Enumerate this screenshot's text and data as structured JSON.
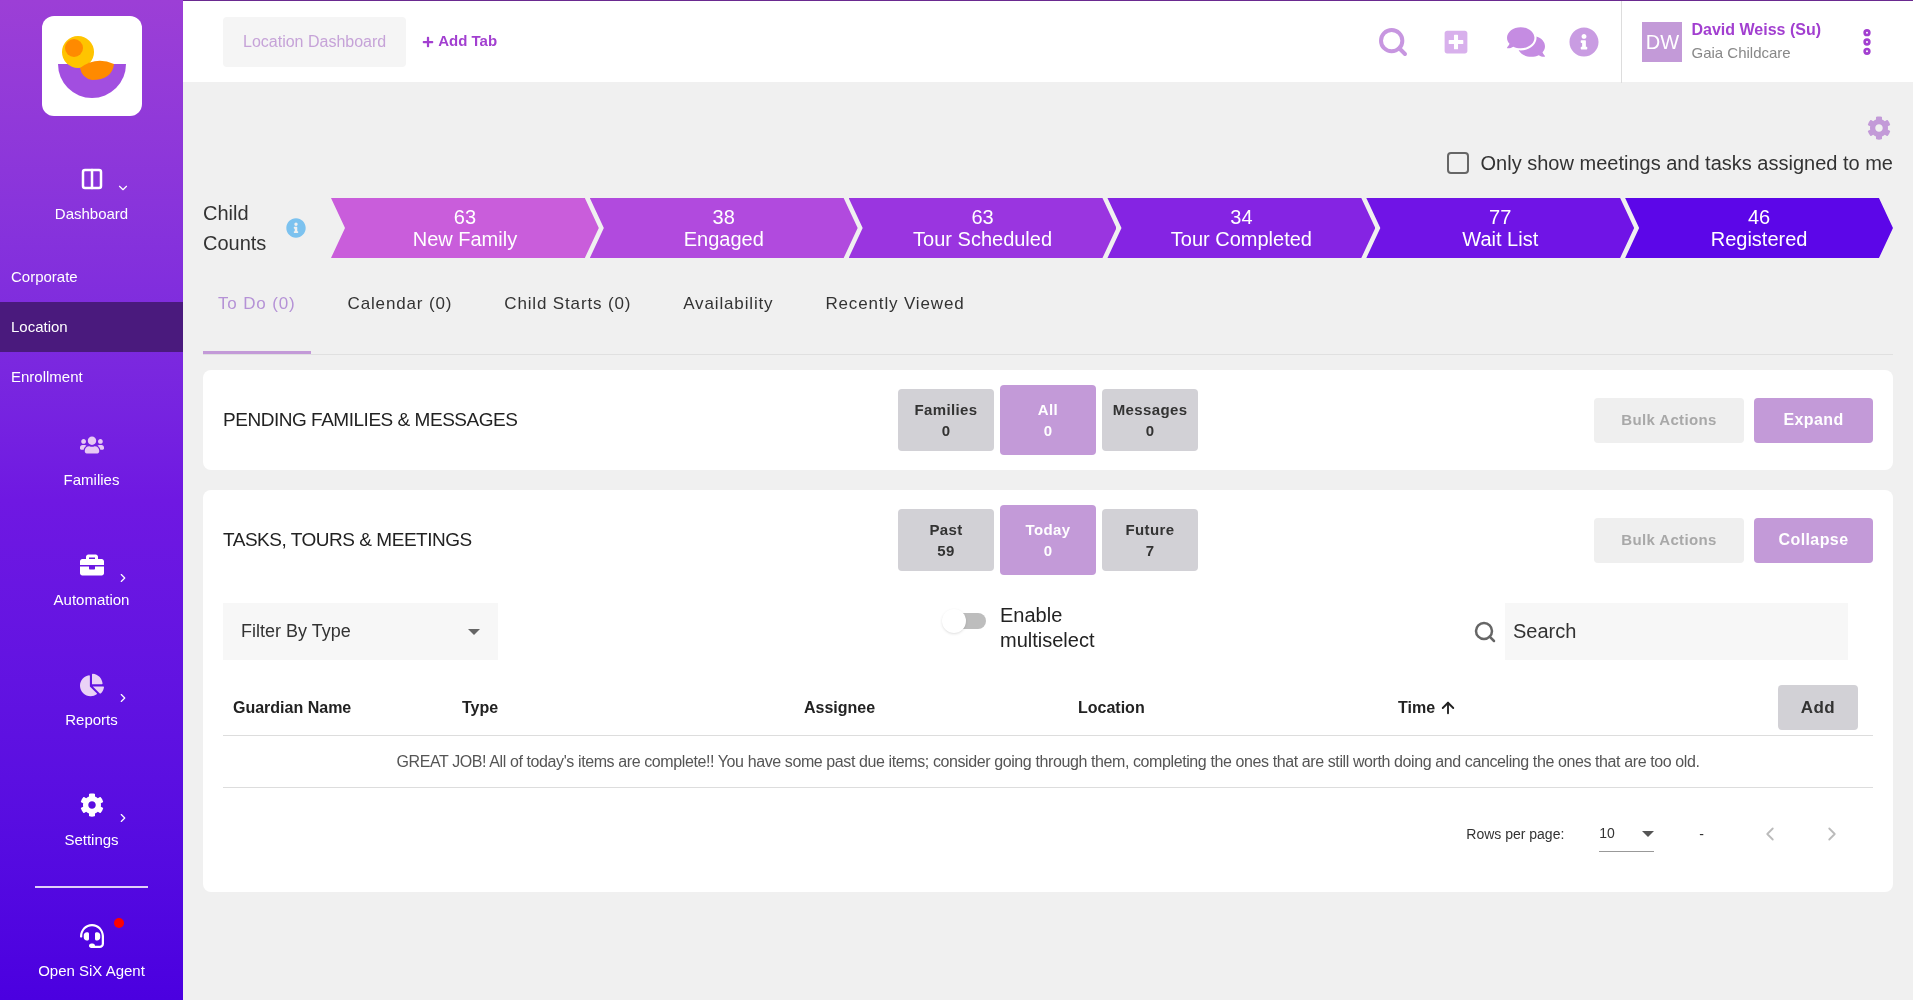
{
  "sidebar": {
    "items": [
      {
        "label": "Dashboard",
        "kind": "menu",
        "expanded": true,
        "children": [
          {
            "label": "Corporate",
            "selected": false
          },
          {
            "label": "Location",
            "selected": true
          },
          {
            "label": "Enrollment",
            "selected": false
          }
        ]
      },
      {
        "label": "Families",
        "kind": "link"
      },
      {
        "label": "Automation",
        "kind": "menu",
        "expanded": false
      },
      {
        "label": "Reports",
        "kind": "menu",
        "expanded": false
      },
      {
        "label": "Settings",
        "kind": "menu",
        "expanded": false
      }
    ],
    "agent": {
      "label": "Open SiX Agent",
      "alert": true
    }
  },
  "top_bar": {
    "tabs": [
      {
        "label": "Location Dashboard",
        "selected": true
      }
    ],
    "add_tab": "Add Tab",
    "user": {
      "initials": "DW",
      "name": "David Weiss (Su)",
      "organization": "Gaia Childcare"
    }
  },
  "assigned_filter": {
    "label": "Only show meetings and tasks assigned to me",
    "checked": false
  },
  "child_counts": {
    "label": "Child Counts",
    "stages": [
      {
        "count": "63",
        "name": "New Family",
        "color": "#c95ddb"
      },
      {
        "count": "38",
        "name": "Engaged",
        "color": "#b14ade"
      },
      {
        "count": "63",
        "name": "Tour Scheduled",
        "color": "#9a35e0"
      },
      {
        "count": "34",
        "name": "Tour Completed",
        "color": "#8524e3"
      },
      {
        "count": "77",
        "name": "Wait List",
        "color": "#7014e6"
      },
      {
        "count": "46",
        "name": "Registered",
        "color": "#5c06e8"
      }
    ]
  },
  "tabs": [
    {
      "label": "To Do (0)",
      "selected": true
    },
    {
      "label": "Calendar (0)",
      "selected": false
    },
    {
      "label": "Child Starts (0)",
      "selected": false
    },
    {
      "label": "Availability",
      "selected": false
    },
    {
      "label": "Recently Viewed",
      "selected": false
    }
  ],
  "pending": {
    "title": "PENDING FAMILIES & MESSAGES",
    "filters": [
      {
        "label": "Families",
        "count": "0",
        "selected": false
      },
      {
        "label": "All",
        "count": "0",
        "selected": true
      },
      {
        "label": "Messages",
        "count": "0",
        "selected": false
      }
    ],
    "bulk_actions": {
      "label": "Bulk Actions",
      "disabled": true
    },
    "toggle_button": "Expand"
  },
  "tasks": {
    "title": "TASKS, TOURS & MEETINGS",
    "filters": [
      {
        "label": "Past",
        "count": "59",
        "selected": false
      },
      {
        "label": "Today",
        "count": "0",
        "selected": true
      },
      {
        "label": "Future",
        "count": "7",
        "selected": false
      }
    ],
    "bulk_actions": {
      "label": "Bulk Actions",
      "disabled": true
    },
    "toggle_button": "Collapse",
    "type_filter": "Filter By Type",
    "multiselect": {
      "label": "Enable multiselect",
      "on": false
    },
    "search": {
      "placeholder": "Search"
    },
    "columns": [
      {
        "label": "Guardian Name",
        "sorted": false
      },
      {
        "label": "Type",
        "sorted": false
      },
      {
        "label": "Assignee",
        "sorted": false
      },
      {
        "label": "Location",
        "sorted": false
      },
      {
        "label": "Time",
        "sorted": true
      }
    ],
    "add_button": "Add",
    "message": "GREAT JOB! All of today's items are complete!! You have some past due items; consider going through them, completing the ones that are still worth doing and canceling the ones that are too old.",
    "pagination": {
      "rows_per_page_label": "Rows per page:",
      "rows_per_page": "10",
      "range": "-"
    }
  }
}
